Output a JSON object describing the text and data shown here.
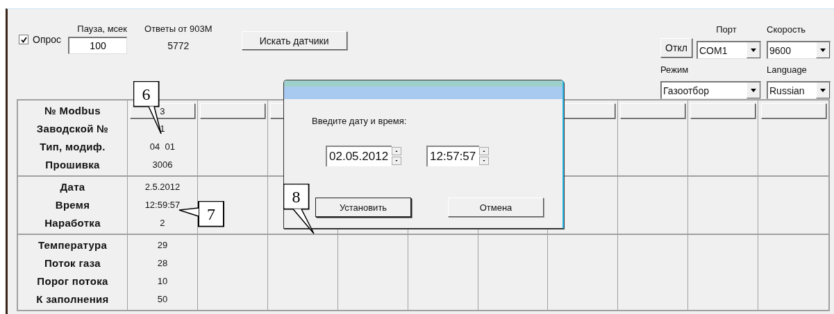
{
  "toolbar": {
    "poll": {
      "label": "Опрос",
      "checked": true
    },
    "pause": {
      "label": "Пауза, мсек",
      "value": "100"
    },
    "responses": {
      "label": "Ответы от 903М",
      "value": "5772"
    },
    "search_button": "Искать датчики",
    "port": {
      "label": "Порт",
      "disconnect_button": "Откл",
      "value": "COM1"
    },
    "speed": {
      "label": "Скорость",
      "value": "9600"
    },
    "mode": {
      "label": "Режим",
      "value": "Газоотбор"
    },
    "language": {
      "label": "Language",
      "value": "Russian"
    }
  },
  "table": {
    "groups": [
      {
        "labels": [
          "№ Modbus",
          "Заводской №",
          "Тип, модиф.",
          "Прошивка"
        ]
      },
      {
        "labels": [
          "Дата",
          "Время",
          "Наработка"
        ]
      },
      {
        "labels": [
          "Температура",
          "Поток газа",
          "Порог потока",
          "К заполнения"
        ]
      }
    ],
    "columns": [
      {
        "kind": "filled",
        "header": "3",
        "cells": [
          [
            "1",
            "04  01",
            "3006"
          ],
          [
            "2.5.2012",
            "12:59:57",
            "2"
          ],
          [
            "29",
            "28",
            "10",
            "50"
          ]
        ]
      },
      {
        "kind": "empty"
      },
      {
        "kind": "empty"
      },
      {
        "kind": "empty"
      },
      {
        "kind": "empty"
      },
      {
        "kind": "empty"
      },
      {
        "kind": "empty"
      },
      {
        "kind": "empty"
      },
      {
        "kind": "empty"
      },
      {
        "kind": "empty"
      }
    ]
  },
  "dialog": {
    "prompt": "Введите дату и время:",
    "date": "02.05.2012",
    "time": "12:57:57",
    "buttons": [
      {
        "label": "Установить",
        "default": true
      },
      {
        "label": "Отмена",
        "default": false
      }
    ]
  },
  "callouts": [
    {
      "label": "6"
    },
    {
      "label": "7"
    },
    {
      "label": "8"
    }
  ]
}
